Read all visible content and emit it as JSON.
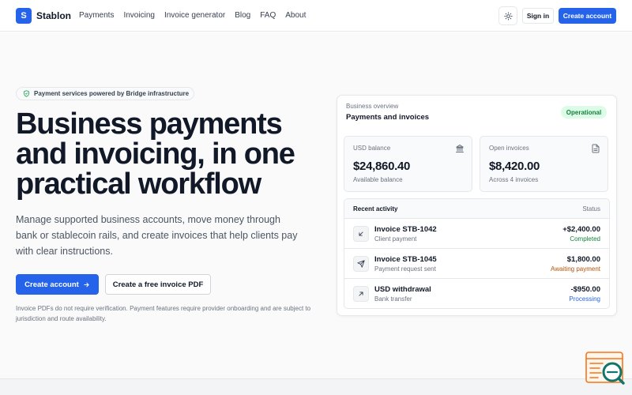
{
  "nav": {
    "logo_letter": "S",
    "brand": "Stablon",
    "links": [
      "Payments",
      "Invoicing",
      "Invoice generator",
      "Blog",
      "FAQ",
      "About"
    ],
    "signin": "Sign in",
    "create_account": "Create account",
    "theme_icon": "sun-icon"
  },
  "hero": {
    "badge": "Payment services powered by Bridge infrastructure",
    "headline_lines": [
      "Business payments",
      "and invoicing, in one",
      "practical workflow"
    ],
    "subtext": "Manage supported business accounts, move money through bank or stablecoin rails, and create invoices that help clients pay with clear instructions.",
    "cta_primary": "Create account",
    "cta_secondary": "Create a free invoice PDF",
    "note": "Invoice PDFs do not require verification. Payment features require provider onboarding and are subject to jurisdiction and route availability."
  },
  "card": {
    "subtitle": "Business overview",
    "title": "Payments and invoices",
    "status": "Operational",
    "stats": [
      {
        "label": "USD balance",
        "value": "$24,860.40",
        "caption": "Available balance",
        "icon": "bank-icon"
      },
      {
        "label": "Open invoices",
        "value": "$8,420.00",
        "caption": "Across 4 invoices",
        "icon": "document-icon"
      }
    ],
    "activity": {
      "title": "Recent activity",
      "status_header": "Status",
      "rows": [
        {
          "title": "Invoice STB-1042",
          "sub": "Client payment",
          "amount": "+$2,400.00",
          "status": "Completed",
          "icon": "arrow-down-left-icon"
        },
        {
          "title": "Invoice STB-1045",
          "sub": "Payment request sent",
          "amount": "$1,800.00",
          "status": "Awaiting payment",
          "icon": "send-icon"
        },
        {
          "title": "USD withdrawal",
          "sub": "Bank transfer",
          "amount": "-$950.00",
          "status": "Processing",
          "icon": "arrow-up-right-icon"
        }
      ]
    }
  },
  "colors": {
    "primary": "#2563eb",
    "completed": "#15803d",
    "awaiting": "#b45309",
    "processing": "#2563eb",
    "widget_accent": "#f97316",
    "widget_dark": "#0f766e"
  }
}
